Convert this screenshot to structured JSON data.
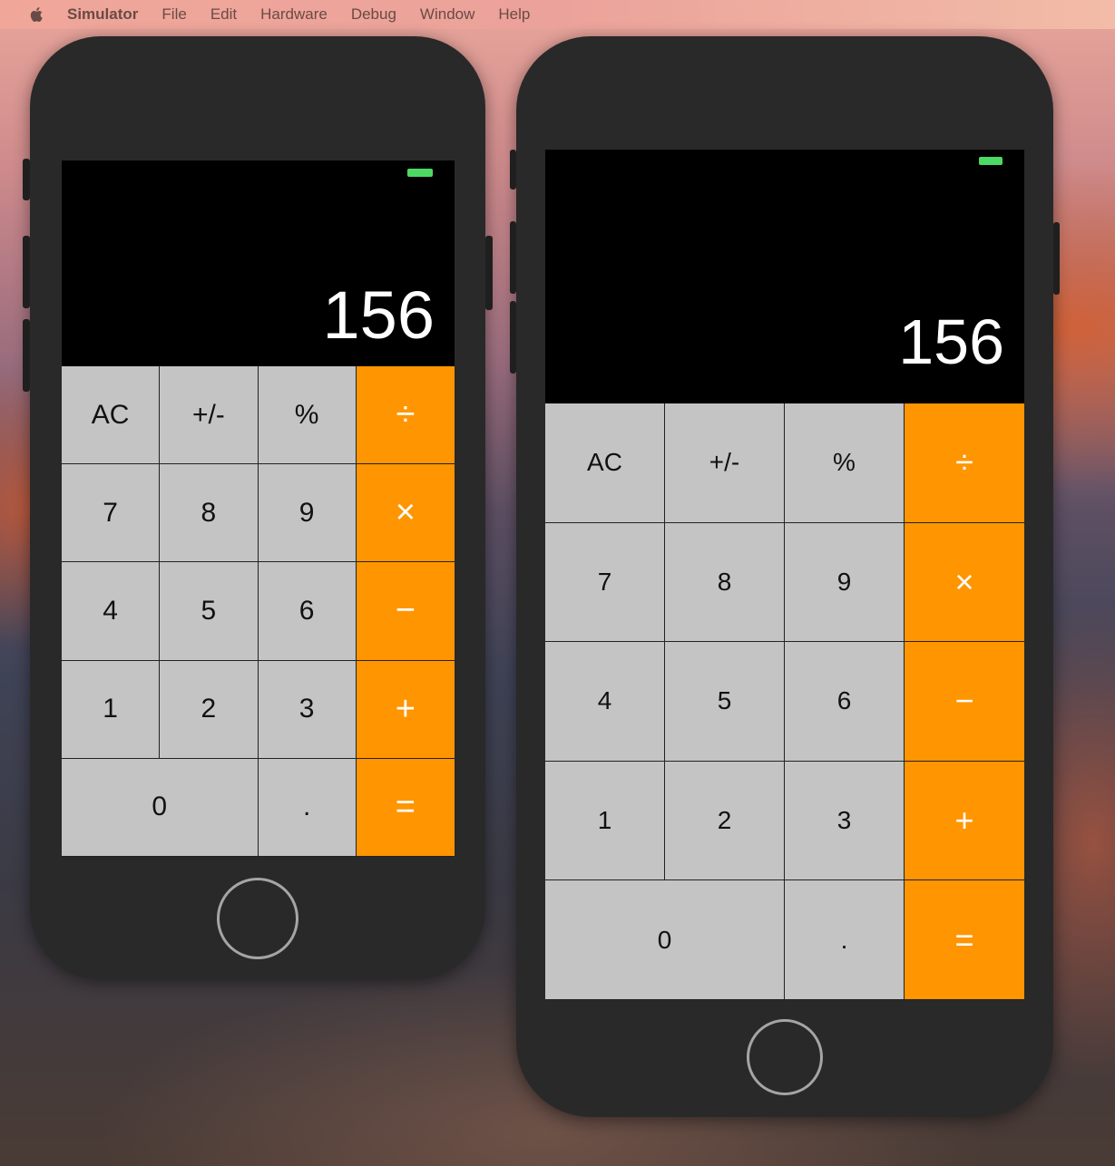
{
  "menubar": {
    "app_name": "Simulator",
    "items": [
      "File",
      "Edit",
      "Hardware",
      "Debug",
      "Window",
      "Help"
    ]
  },
  "devices": [
    {
      "display_value": "156",
      "keys": {
        "ac": "AC",
        "sign": "+/-",
        "percent": "%",
        "divide": "÷",
        "seven": "7",
        "eight": "8",
        "nine": "9",
        "multiply": "×",
        "four": "4",
        "five": "5",
        "six": "6",
        "minus": "−",
        "one": "1",
        "two": "2",
        "three": "3",
        "plus": "+",
        "zero": "0",
        "dot": ".",
        "equals": "="
      }
    },
    {
      "display_value": "156",
      "keys": {
        "ac": "AC",
        "sign": "+/-",
        "percent": "%",
        "divide": "÷",
        "seven": "7",
        "eight": "8",
        "nine": "9",
        "multiply": "×",
        "four": "4",
        "five": "5",
        "six": "6",
        "minus": "−",
        "one": "1",
        "two": "2",
        "three": "3",
        "plus": "+",
        "zero": "0",
        "dot": ".",
        "equals": "="
      }
    }
  ],
  "colors": {
    "operator": "#ff9500",
    "function_key": "#c4c4c4",
    "battery": "#4cd964",
    "device_body": "#292929"
  },
  "icons": {
    "menu_logo": "apple-logo-icon",
    "battery": "battery-icon",
    "home": "home-button"
  }
}
